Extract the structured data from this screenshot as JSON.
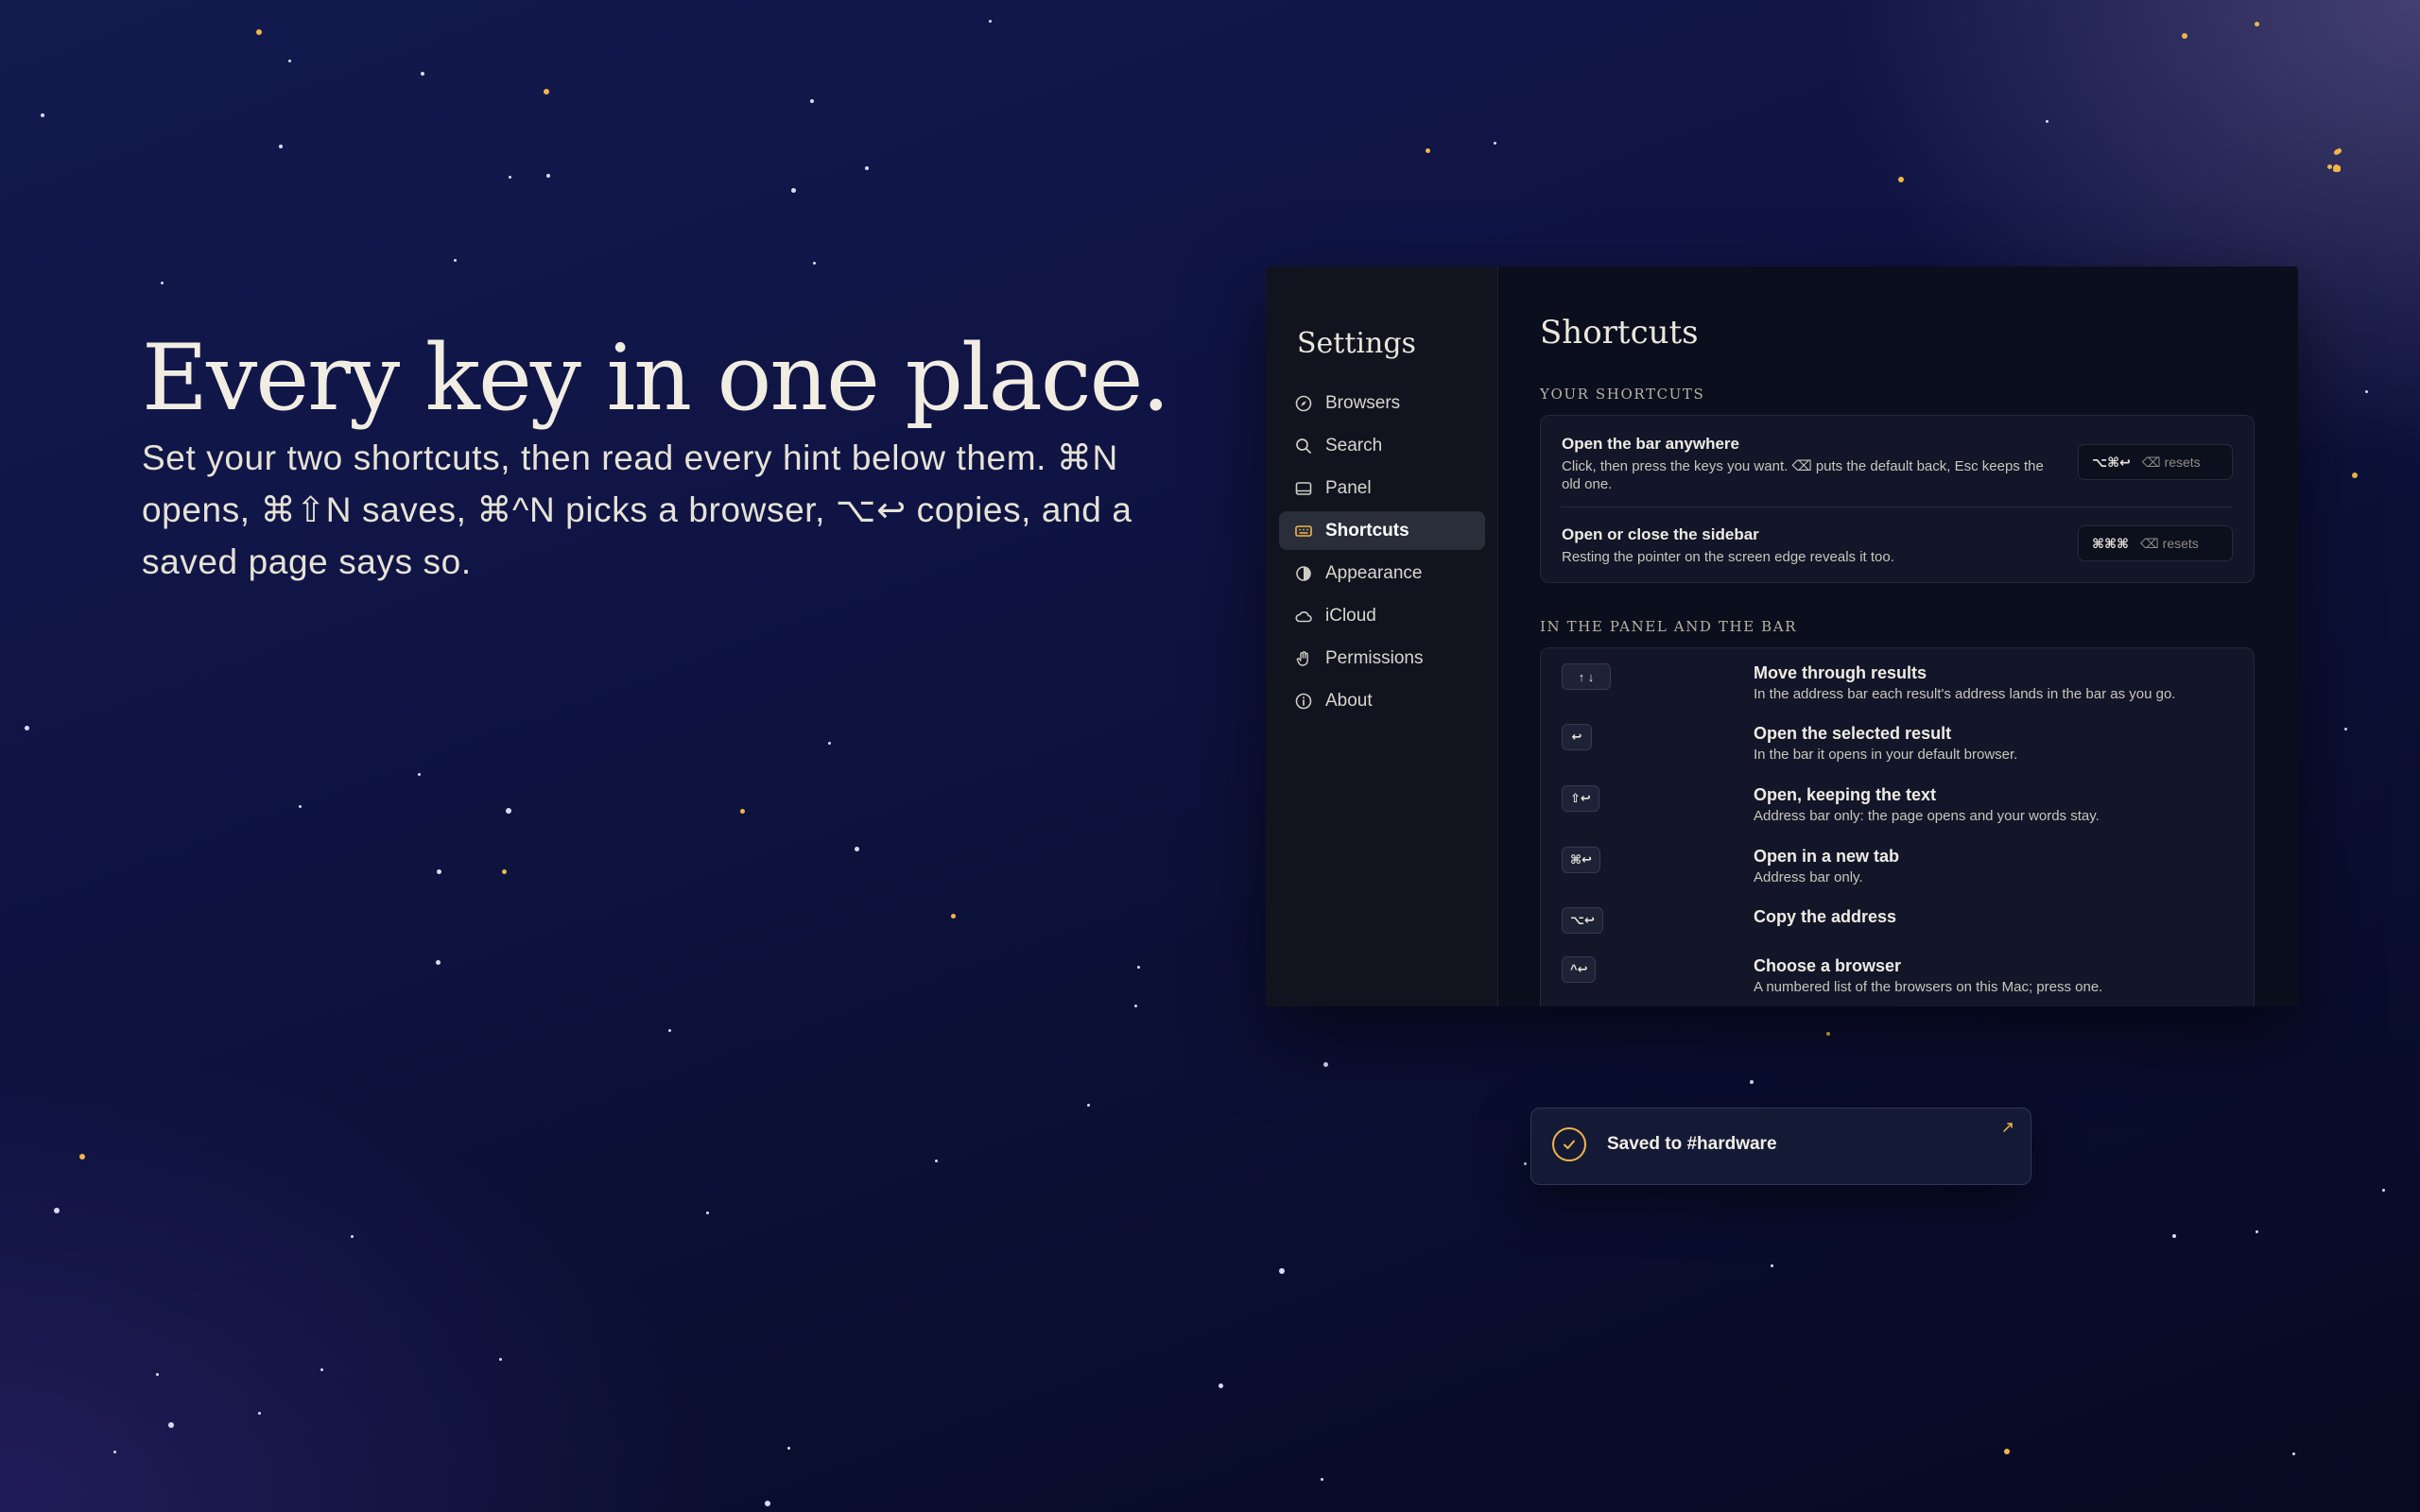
{
  "hero": {
    "title": "Every key in one place.",
    "subtitle": "Set your two shortcuts, then read every hint below them. ⌘N opens, ⌘⇧N saves, ⌘^N picks a browser, ⌥↩ copies, and a saved page says so."
  },
  "settings": {
    "sidebar": {
      "title": "Settings",
      "items": [
        {
          "label": "Browsers",
          "icon": "compass-icon"
        },
        {
          "label": "Search",
          "icon": "search-icon"
        },
        {
          "label": "Panel",
          "icon": "panel-icon"
        },
        {
          "label": "Shortcuts",
          "icon": "keyboard-icon",
          "active": true
        },
        {
          "label": "Appearance",
          "icon": "contrast-icon"
        },
        {
          "label": "iCloud",
          "icon": "cloud-icon"
        },
        {
          "label": "Permissions",
          "icon": "hand-icon"
        },
        {
          "label": "About",
          "icon": "info-icon"
        }
      ]
    },
    "page_title": "Shortcuts",
    "your_shortcuts": {
      "label": "YOUR SHORTCUTS",
      "rows": [
        {
          "title": "Open the bar anywhere",
          "desc": "Click, then press the keys you want. ⌫ puts the default back, Esc keeps the old one.",
          "keys": "⌥⌘↩",
          "reset": "⌫ resets"
        },
        {
          "title": "Open or close the sidebar",
          "desc": "Resting the pointer on the screen edge reveals it too.",
          "keys": "⌘⌘⌘",
          "reset": "⌫ resets"
        }
      ]
    },
    "panel_bar": {
      "label": "IN THE PANEL AND THE BAR",
      "rows": [
        {
          "keys": "↑ ↓",
          "title": "Move through results",
          "desc": "In the address bar each result's address lands in the bar as you go."
        },
        {
          "keys": "↩",
          "title": "Open the selected result",
          "desc": "In the bar it opens in your default browser."
        },
        {
          "keys": "⇧↩",
          "title": "Open, keeping the text",
          "desc": "Address bar only: the page opens and your words stay."
        },
        {
          "keys": "⌘↩",
          "title": "Open in a new tab",
          "desc": "Address bar only."
        },
        {
          "keys": "⌥↩",
          "title": "Copy the address",
          "desc": ""
        },
        {
          "keys": "^↩",
          "title": "Choose a browser",
          "desc": "A numbered list of the browsers on this Mac; press one."
        }
      ]
    }
  },
  "toast": {
    "message": "Saved to #hardware",
    "accent": "#f0b54a"
  }
}
